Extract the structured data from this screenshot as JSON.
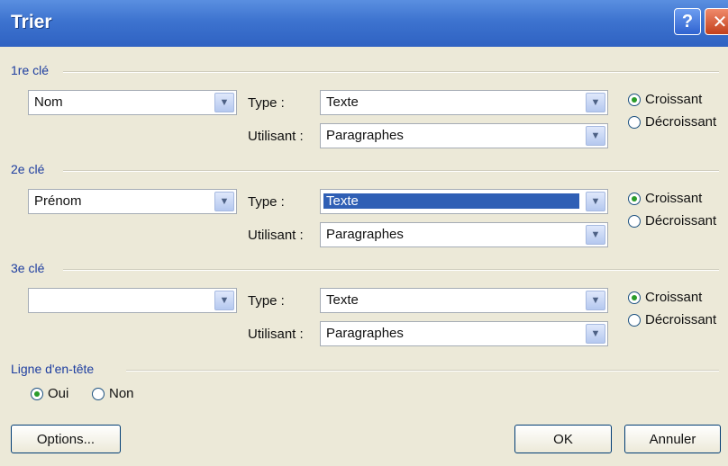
{
  "window": {
    "title": "Trier",
    "help_glyph": "?",
    "close_glyph": "✕"
  },
  "keys": [
    {
      "section": "1re clé",
      "field": "Nom",
      "type_label": "Type :",
      "type_value": "Texte",
      "using_label": "Utilisant :",
      "using_value": "Paragraphes",
      "asc_label": "Croissant",
      "desc_label": "Décroissant",
      "order": "asc"
    },
    {
      "section": "2e clé",
      "field": "Prénom",
      "type_label": "Type :",
      "type_value": "Texte",
      "using_label": "Utilisant :",
      "using_value": "Paragraphes",
      "asc_label": "Croissant",
      "desc_label": "Décroissant",
      "order": "asc"
    },
    {
      "section": "3e clé",
      "field": "",
      "type_label": "Type :",
      "type_value": "Texte",
      "using_label": "Utilisant :",
      "using_value": "Paragraphes",
      "asc_label": "Croissant",
      "desc_label": "Décroissant",
      "order": "asc"
    }
  ],
  "header_row": {
    "section": "Ligne d'en-tête",
    "yes_label": "Oui",
    "no_label": "Non",
    "selected": "yes"
  },
  "buttons": {
    "options": "Options...",
    "ok": "OK",
    "cancel": "Annuler"
  },
  "icons": {
    "dropdown": "▼"
  }
}
